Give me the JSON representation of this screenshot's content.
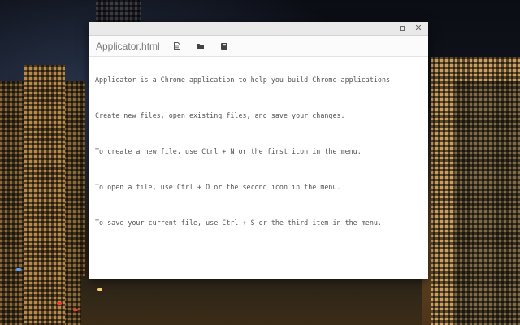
{
  "window": {
    "title": "Applicator.html",
    "controls": [
      "maximize-icon",
      "close-icon"
    ]
  },
  "toolbar": {
    "buttons": [
      {
        "icon": "new-file-icon"
      },
      {
        "icon": "folder-open-icon"
      },
      {
        "icon": "save-icon"
      }
    ]
  },
  "editor": {
    "lines": [
      "Applicator is a Chrome application to help you build Chrome applications.",
      "Create new files, open existing files, and save your changes.",
      "To create a new file, use Ctrl + N or the first icon in the menu.",
      "To open a file, use Ctrl + O or the second icon in the menu.",
      "To save your current file, use Ctrl + S or the third item in the menu."
    ]
  }
}
